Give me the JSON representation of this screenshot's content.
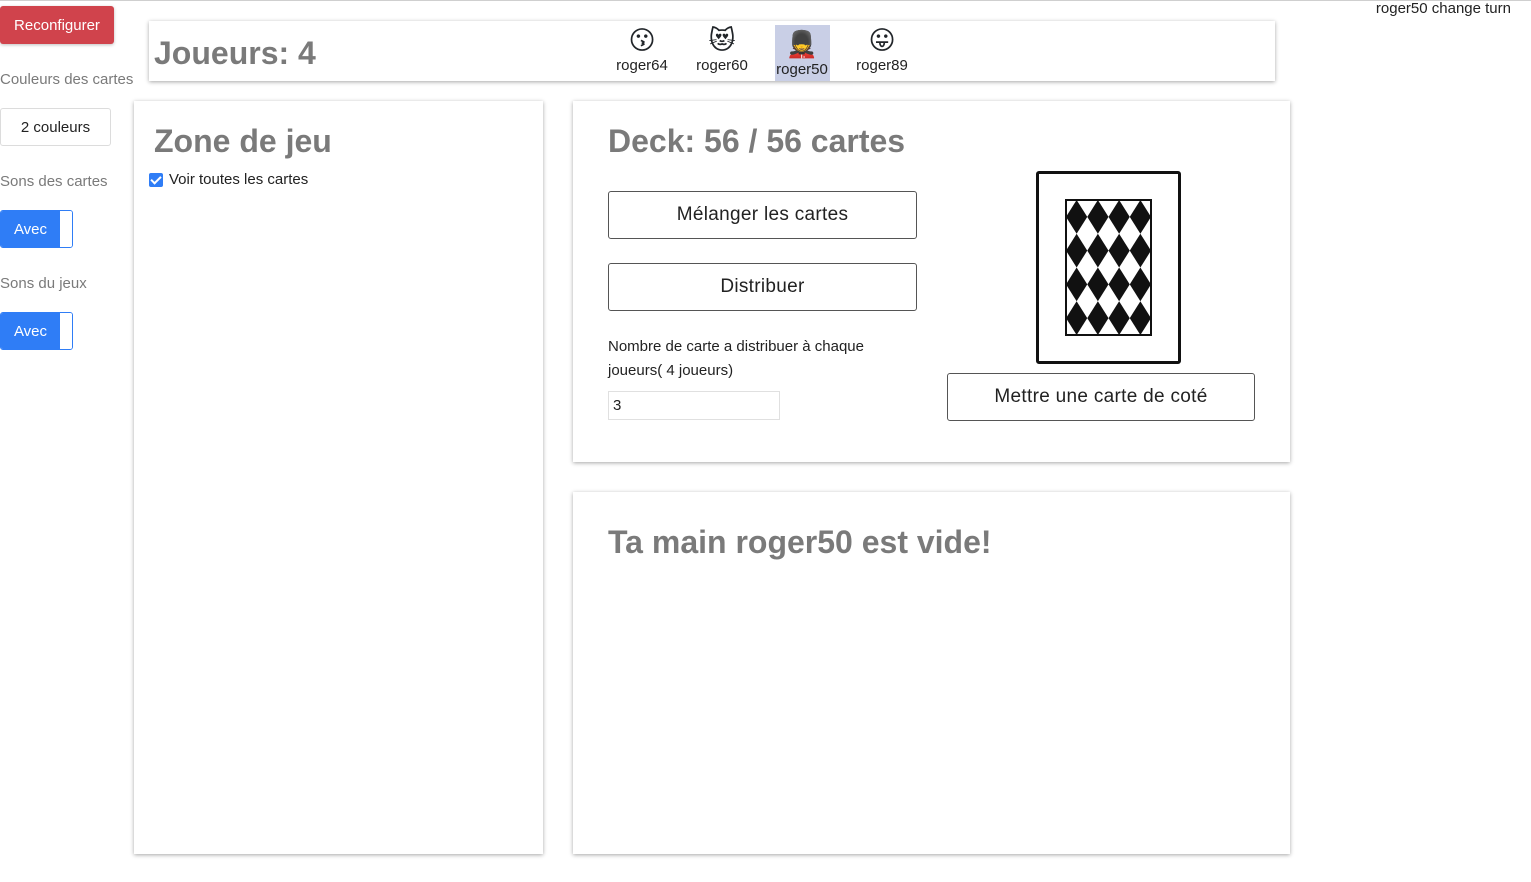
{
  "status": {
    "turn_message": "roger50 change turn"
  },
  "sidebar": {
    "reconfigure_label": "Reconfigurer",
    "card_colors_label": "Couleurs des cartes",
    "card_colors_value": "2 couleurs",
    "card_sounds_label": "Sons des cartes",
    "card_sounds_toggle": "Avec",
    "game_sounds_label": "Sons du jeux",
    "game_sounds_toggle": "Avec"
  },
  "players": {
    "title": "Joueurs: 4",
    "list": [
      {
        "name": "roger64",
        "emoji": "😗",
        "active": false
      },
      {
        "name": "roger60",
        "emoji": "😻",
        "active": false
      },
      {
        "name": "roger50",
        "emoji": "💂",
        "active": true
      },
      {
        "name": "roger89",
        "emoji": "😛",
        "active": false
      }
    ]
  },
  "zone": {
    "title": "Zone de jeu",
    "show_all_label": "Voir toutes les cartes",
    "show_all_checked": true
  },
  "deck": {
    "title": "Deck: 56 / 56 cartes",
    "shuffle_label": "Mélanger les cartes",
    "deal_label": "Distribuer",
    "deal_count_label": "Nombre de carte a distribuer à chaque joueurs( 4 joueurs)",
    "deal_count_value": "3",
    "set_aside_label": "Mettre une carte de coté"
  },
  "hand": {
    "title": "Ta main roger50 est vide!"
  },
  "colors": {
    "accent": "#2f7df6",
    "danger": "#d0434c",
    "active_player_bg": "#c9cfe6"
  }
}
